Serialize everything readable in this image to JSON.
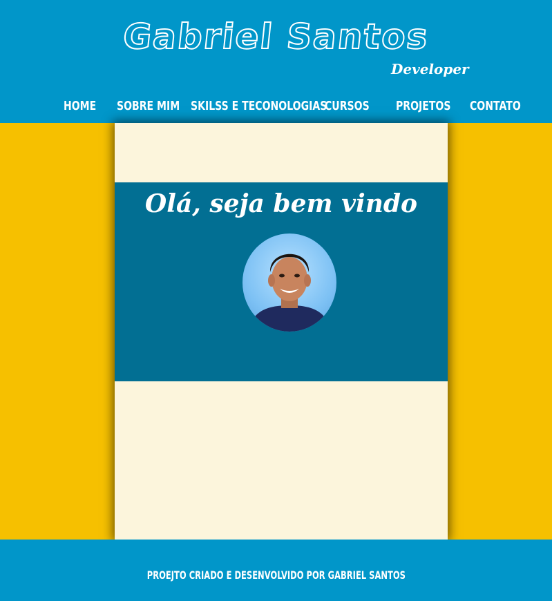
{
  "header": {
    "logo_title": "Gabriel Santos",
    "logo_subtitle": "Developer"
  },
  "nav": {
    "items": [
      {
        "label": "Home"
      },
      {
        "label": "Sobre mim"
      },
      {
        "label": "Skilss e teconologias"
      },
      {
        "label": "Cursos"
      },
      {
        "label": "Projetos"
      },
      {
        "label": "Contato"
      }
    ]
  },
  "main": {
    "welcome_text": "Olá, seja bem vindo"
  },
  "footer": {
    "text": "Proejto criado e desenvolvido por Gabriel Santos"
  },
  "colors": {
    "header_bg": "#0196c9",
    "page_bg": "#f6c000",
    "panel_bg": "#fcf5dc",
    "band_bg": "#026f93",
    "text": "#ffffff"
  }
}
